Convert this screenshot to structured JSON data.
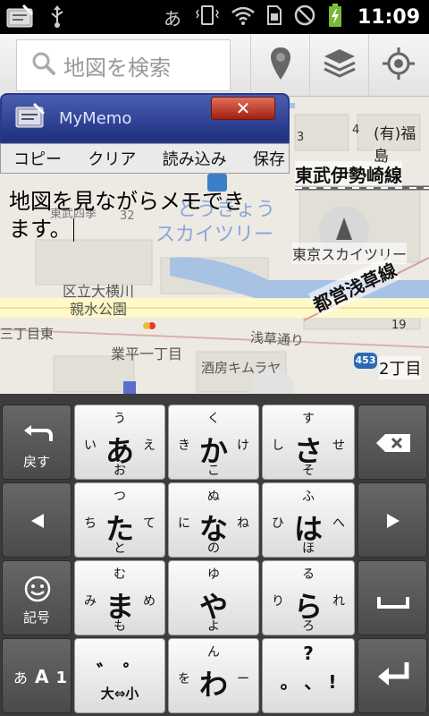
{
  "statusbar": {
    "time": "11:09",
    "input_indicator": "あ"
  },
  "search": {
    "placeholder": "地図を検索"
  },
  "map_labels": {
    "tobu_line": "東武伊勢崎線",
    "toei_line": "都営浅草線",
    "skytree_station": "とうきょう",
    "skytree_station2": "スカイツリー",
    "skytree": "東京スカイツリー",
    "park1": "区立大横川",
    "park2": "親水公園",
    "narihira": "業平一丁目",
    "sanchome": "三丁目東",
    "asakusa": "浅草通り",
    "kimuraya": "酒房キムラヤ",
    "route": "453",
    "nichome": "2丁目",
    "fukushima": "(有)福島",
    "num4": "4",
    "num3": "3",
    "num19": "19",
    "num32": "32",
    "higashi": "東武四季"
  },
  "memo": {
    "title": "MyMemo",
    "close": "✕",
    "menu": [
      "コピー",
      "クリア",
      "読み込み",
      "保存"
    ],
    "text_line1": "地図を見ながらメモでき",
    "text_line2": "ます。"
  },
  "keyboard": {
    "back": "戻す",
    "kigou": "記号",
    "mode_a": "あ",
    "mode_A": "A",
    "mode_1": "1",
    "keys": [
      {
        "main": "あ",
        "up": "う",
        "down": "お",
        "left": "い",
        "right": "え"
      },
      {
        "main": "か",
        "up": "く",
        "down": "こ",
        "left": "き",
        "right": "け"
      },
      {
        "main": "さ",
        "up": "す",
        "down": "そ",
        "left": "し",
        "right": "せ"
      },
      {
        "main": "た",
        "up": "つ",
        "down": "と",
        "left": "ち",
        "right": "て"
      },
      {
        "main": "な",
        "up": "ぬ",
        "down": "の",
        "left": "に",
        "right": "ね"
      },
      {
        "main": "は",
        "up": "ふ",
        "down": "ほ",
        "left": "ひ",
        "right": "へ"
      },
      {
        "main": "ま",
        "up": "む",
        "down": "も",
        "left": "み",
        "right": "め"
      },
      {
        "main": "や",
        "up": "ゆ",
        "down": "よ",
        "left": "",
        "right": ""
      },
      {
        "main": "ら",
        "up": "る",
        "down": "ろ",
        "left": "り",
        "right": "れ"
      },
      {
        "main": "わ",
        "up": "ん",
        "down": "",
        "left": "を",
        "right": "ー"
      }
    ],
    "dakuten": "゛ ゜",
    "daisho": "大⇔小",
    "punct_up": "?",
    "punct_main": "。 、 !"
  }
}
